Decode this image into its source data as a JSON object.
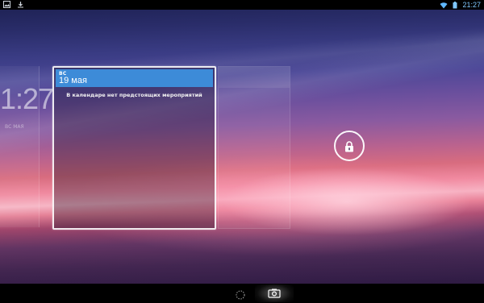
{
  "status_bar": {
    "time": "21:27",
    "left_icons": [
      "image-notification-icon",
      "download-icon"
    ],
    "right_icons": [
      "wifi-icon",
      "battery-icon"
    ]
  },
  "clock_widget": {
    "time": "1:27",
    "day": "ВС МАЯ"
  },
  "calendar": {
    "weekday": "ВС",
    "date": "19 мая",
    "message": "В календаре нет предстоящих мероприятий"
  },
  "lock": {
    "icon": "lock-icon"
  },
  "nav_bar": {
    "icons": [
      "loading-spinner-icon",
      "camera-icon"
    ]
  }
}
